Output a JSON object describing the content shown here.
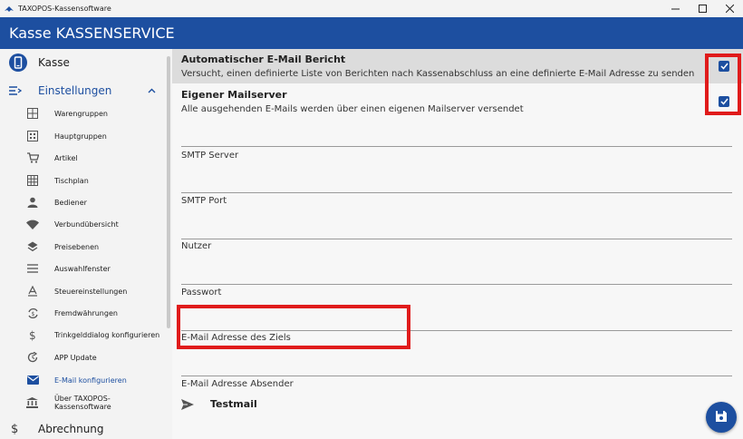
{
  "window": {
    "title": "TAXOPOS-Kassensoftware"
  },
  "header": {
    "title": "Kasse KASSENSERVICE"
  },
  "sidebar": {
    "top_item": {
      "label": "Kasse",
      "icon": "phone-device-icon"
    },
    "section": {
      "label": "Einstellungen",
      "icon": "settings-list-icon",
      "expanded": true
    },
    "items": [
      {
        "label": "Warengruppen",
        "icon": "grid-icon"
      },
      {
        "label": "Hauptgruppen",
        "icon": "main-groups-icon"
      },
      {
        "label": "Artikel",
        "icon": "cart-icon"
      },
      {
        "label": "Tischplan",
        "icon": "table-grid-icon"
      },
      {
        "label": "Bediener",
        "icon": "person-icon"
      },
      {
        "label": "Verbundübersicht",
        "icon": "wifi-icon"
      },
      {
        "label": "Preisebenen",
        "icon": "layers-icon"
      },
      {
        "label": "Auswahlfenster",
        "icon": "menu-lines-icon"
      },
      {
        "label": "Steuereinstellungen",
        "icon": "tax-icon"
      },
      {
        "label": "Fremdwährungen",
        "icon": "currency-exchange-icon"
      },
      {
        "label": "Trinkgelddialog konfigurieren",
        "icon": "dollar-icon"
      },
      {
        "label": "APP Update",
        "icon": "update-icon"
      },
      {
        "label": "E-Mail konfigurieren",
        "icon": "mail-icon",
        "active": true
      },
      {
        "label": "Über TAXOPOS-Kassensoftware",
        "icon": "bank-icon"
      }
    ],
    "bottom_item": {
      "label": "Abrechnung",
      "icon": "dollar-icon"
    }
  },
  "main": {
    "settings": [
      {
        "title": "Automatischer E-Mail Bericht",
        "description": "Versucht, einen definierte Liste von Berichten nach Kassenabschluss an eine definierte E-Mail Adresse zu senden",
        "checked": true
      },
      {
        "title": "Eigener Mailserver",
        "description": "Alle ausgehenden E-Mails werden über einen eigenen Mailserver versendet",
        "checked": true
      }
    ],
    "fields": [
      {
        "label": "SMTP Server",
        "value": ""
      },
      {
        "label": "SMTP Port",
        "value": ""
      },
      {
        "label": "Nutzer",
        "value": ""
      },
      {
        "label": "Passwort",
        "value": ""
      },
      {
        "label": "E-Mail Adresse des Ziels",
        "value": ""
      },
      {
        "label": "E-Mail Adresse Absender",
        "value": ""
      }
    ],
    "testmail_label": "Testmail"
  },
  "colors": {
    "accent": "#1d4fa0",
    "highlight": "#e01b1b"
  }
}
